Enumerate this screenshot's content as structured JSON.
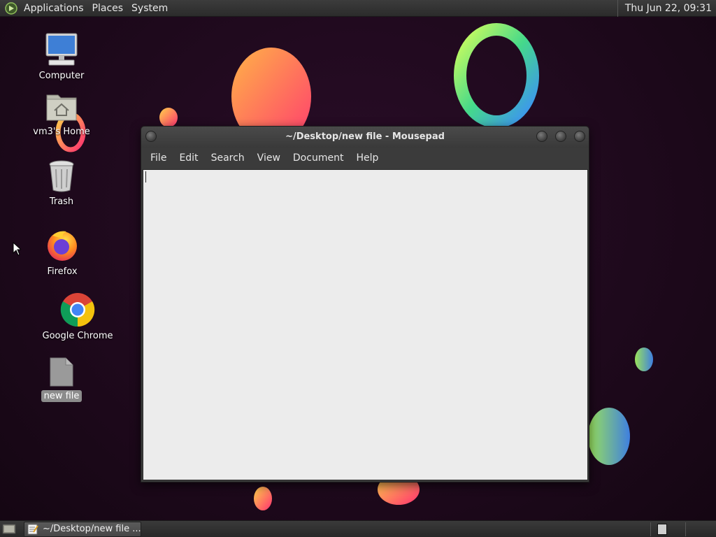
{
  "top_panel": {
    "menus": [
      "Applications",
      "Places",
      "System"
    ],
    "clock": "Thu Jun 22, 09:31"
  },
  "desktop_icons": [
    {
      "label": "Computer",
      "icon": "computer-icon"
    },
    {
      "label": "vm3's Home",
      "icon": "home-folder-icon"
    },
    {
      "label": "Trash",
      "icon": "trash-icon"
    },
    {
      "label": "Firefox",
      "icon": "firefox-icon"
    },
    {
      "label": "Google Chrome",
      "icon": "chrome-icon"
    },
    {
      "label": "new file",
      "icon": "file-icon",
      "selected": true
    }
  ],
  "window": {
    "title": "~/Desktop/new file - Mousepad",
    "menus": [
      "File",
      "Edit",
      "Search",
      "View",
      "Document",
      "Help"
    ],
    "content": ""
  },
  "taskbar": {
    "task_label": "~/Desktop/new file ..."
  },
  "colors": {
    "panel": "#2f2f2f",
    "editor_bg": "#ececec",
    "desktop_bg": "#1d0a1a"
  }
}
